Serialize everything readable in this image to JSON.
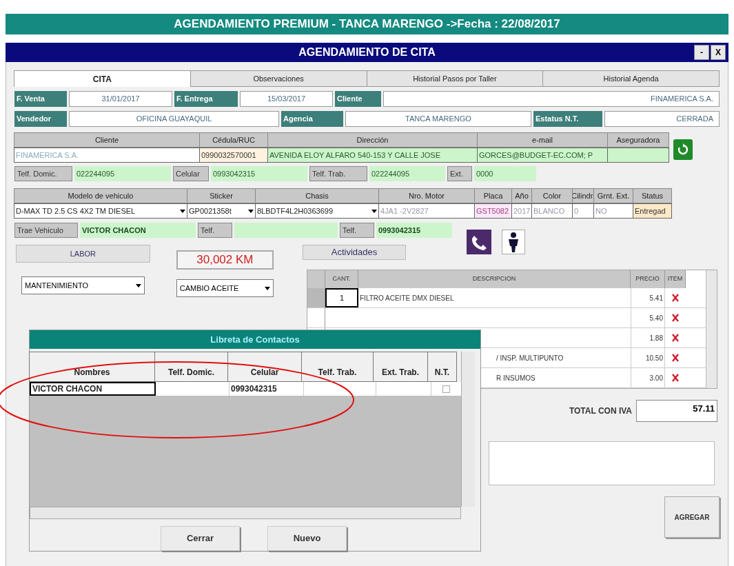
{
  "app_title": "AGENDAMIENTO PREMIUM - TANCA MARENGO ->Fecha : 22/08/2017",
  "window": {
    "title": "AGENDAMIENTO DE CITA",
    "controls": [
      "-",
      "X"
    ]
  },
  "tabs": [
    {
      "label": "CITA",
      "selected": true
    },
    {
      "label": "Observaciones",
      "selected": false
    },
    {
      "label": "Historial Pasos por Taller",
      "selected": false
    },
    {
      "label": "Historial Agenda",
      "selected": false
    }
  ],
  "header_rows": [
    [
      {
        "label": "F. Venta",
        "value": "31/01/2017"
      },
      {
        "label": "F. Entrega",
        "value": "15/03/2017"
      },
      {
        "label": "Cliente",
        "value": "FINAMERICA S.A."
      }
    ],
    [
      {
        "label": "Vendedor",
        "value": "OFICINA GUAYAQUIL"
      },
      {
        "label": "Agencia",
        "value": "TANCA MARENGO"
      },
      {
        "label": "Estatus N.T.",
        "value": "CERRADA"
      }
    ]
  ],
  "client": {
    "columns": [
      "Cliente",
      "Cédula/RUC",
      "Dirección",
      "e-mail",
      "Aseguradora"
    ],
    "values": [
      "FINAMERICA S.A.",
      "0990032570001",
      "AVENIDA ELOY ALFARO 540-153 Y CALLE JOSE",
      "GORCES@BUDGET-EC.COM; P"
    ]
  },
  "phones": [
    {
      "label": "Telf. Domic.",
      "value": "022244095"
    },
    {
      "label": "Celular",
      "value": "0993042315"
    },
    {
      "label": "Telf. Trab.",
      "value": "022244095"
    },
    {
      "label": "Ext.",
      "value": "0000"
    }
  ],
  "vehicle": {
    "columns": [
      "Modelo de vehiculo",
      "Sticker",
      "Chasis",
      "Nro. Motor",
      "Placa",
      "Año",
      "Color",
      "Cilindr.",
      "Grnt. Ext.",
      "Status"
    ],
    "values": [
      {
        "text": "D-MAX TD 2.5 CS 4X2 TM DIESEL",
        "dropdown": true
      },
      {
        "text": "GP0021358t",
        "dropdown": true
      },
      {
        "text": "8LBDTF4L2H0363699",
        "dropdown": true
      },
      {
        "text": "4JA1 -2V2827",
        "dropdown": false
      },
      {
        "text": "GST5082",
        "dropdown": false
      },
      {
        "text": "2017",
        "dropdown": false
      },
      {
        "text": "BLANCO",
        "dropdown": false
      },
      {
        "text": "0",
        "dropdown": false
      },
      {
        "text": "NO",
        "dropdown": false
      },
      {
        "text": "Entregad",
        "dropdown": false
      }
    ]
  },
  "driver": [
    {
      "label": "Trae Vehiculo",
      "value": "VICTOR CHACON"
    },
    {
      "label": "Telf."
    },
    {
      "label": "Telf.",
      "value": "0993042315"
    }
  ],
  "labor": {
    "label": "LABOR",
    "value": "MANTENIMIENTO"
  },
  "mileage": "30,002 KM",
  "service": "CAMBIO ACEITE",
  "activities": {
    "label": "Actividades",
    "columns": [
      "CANT.",
      "DESCRIPCION",
      "PRECIO",
      "ITEM"
    ],
    "rows": [
      {
        "qty": "1",
        "description": "FILTRO ACEITE DMX DIESEL",
        "price": "5.41",
        "selected": true
      },
      {
        "price": "5.40",
        "selected": false
      },
      {
        "price": "1.88",
        "selected": false
      },
      {
        "description": "/ INSP. MULTIPUNTO",
        "price": "10.50"
      },
      {
        "description": "R INSUMOS",
        "price": "3.00"
      }
    ]
  },
  "total": {
    "label": "TOTAL CON IVA",
    "value": "57.11"
  },
  "add_button": "AGREGAR",
  "contacts_dialog": {
    "title": "Libreta de Contactos",
    "columns": [
      "Nombres",
      "Telf. Domic.",
      "Celular",
      "Telf. Trab.",
      "Ext. Trab.",
      "N.T."
    ],
    "rows": [
      {
        "cells": [
          "VICTOR CHACON",
          "",
          "0993042315",
          "",
          ""
        ],
        "checked": false
      }
    ],
    "buttons": [
      "Cerrar",
      "Nuevo"
    ]
  }
}
